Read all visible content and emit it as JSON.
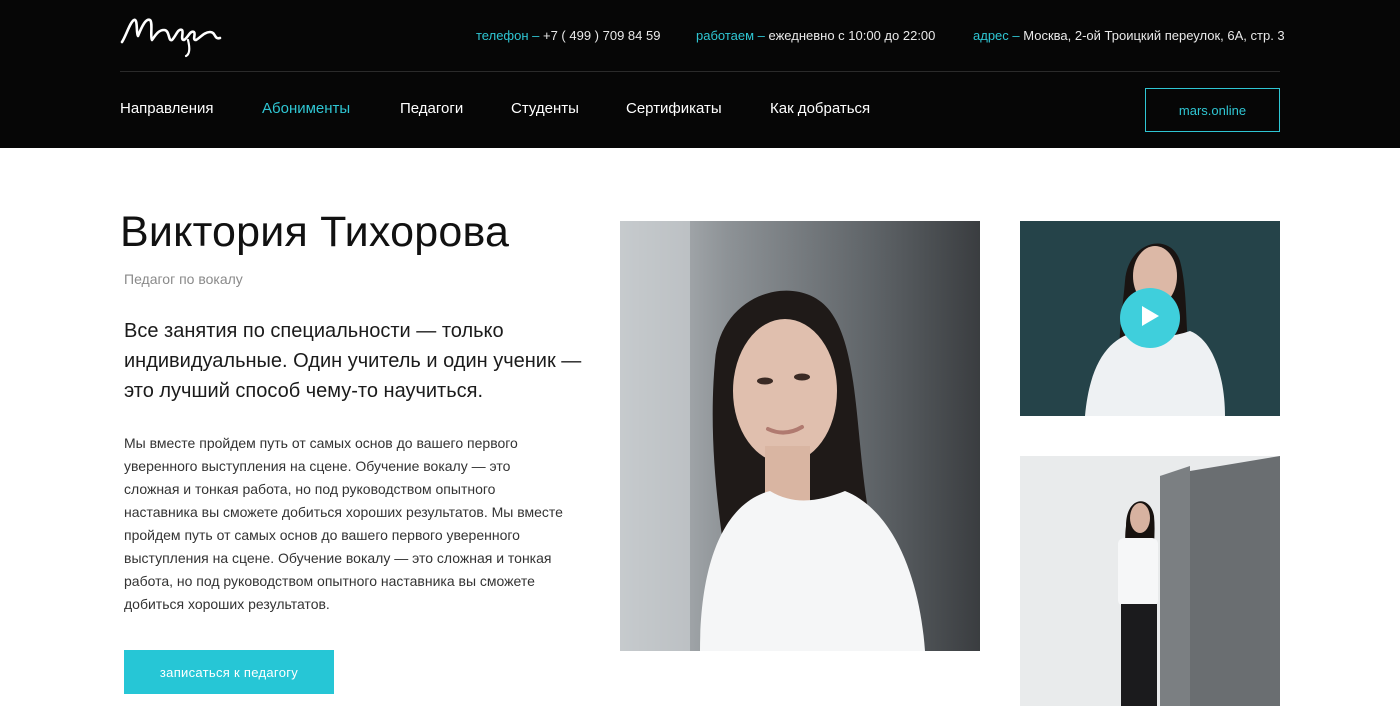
{
  "brand": {
    "logo_text": "Марс"
  },
  "header": {
    "contacts": [
      {
        "label": "телефон –",
        "value": "+7 ( 499 ) 709 84 59"
      },
      {
        "label": "работаем –",
        "value": "ежедневно с 10:00 до 22:00"
      },
      {
        "label": "адрес –",
        "value": "Москва, 2-ой Троицкий переулок, 6А, стр. 3"
      }
    ],
    "nav": [
      "Направления",
      "Абонименты",
      "Педагоги",
      "Студенты",
      "Сертификаты",
      "Как добраться"
    ],
    "active_nav": "Абонименты",
    "online_button": "mars.online"
  },
  "teacher": {
    "name": "Виктория Тихорова",
    "role": "Педагог по вокалу",
    "lead": "Все занятия по специальности — только индивидуальные. Один учитель и один ученик — это лучший способ чему-то научиться.",
    "description": "Мы вместе пройдем путь от самых основ до вашего первого уверенного выступления на сцене. Обучение вокалу — это сложная и тонкая работа, но под руководством опытного наставника вы сможете добиться хороших результатов. Мы вместе пройдем путь от самых основ до вашего первого уверенного выступления на сцене. Обучение вокалу — это сложная и тонкая работа, но под руководством опытного наставника вы сможете добиться хороших результатов.",
    "cta": "записаться к педагогу"
  },
  "colors": {
    "accent": "#2fc6d3",
    "header_bg": "#060606",
    "button_bg": "#26c6d6"
  },
  "icons": {
    "play": "play-icon",
    "logo": "mars-logo"
  }
}
